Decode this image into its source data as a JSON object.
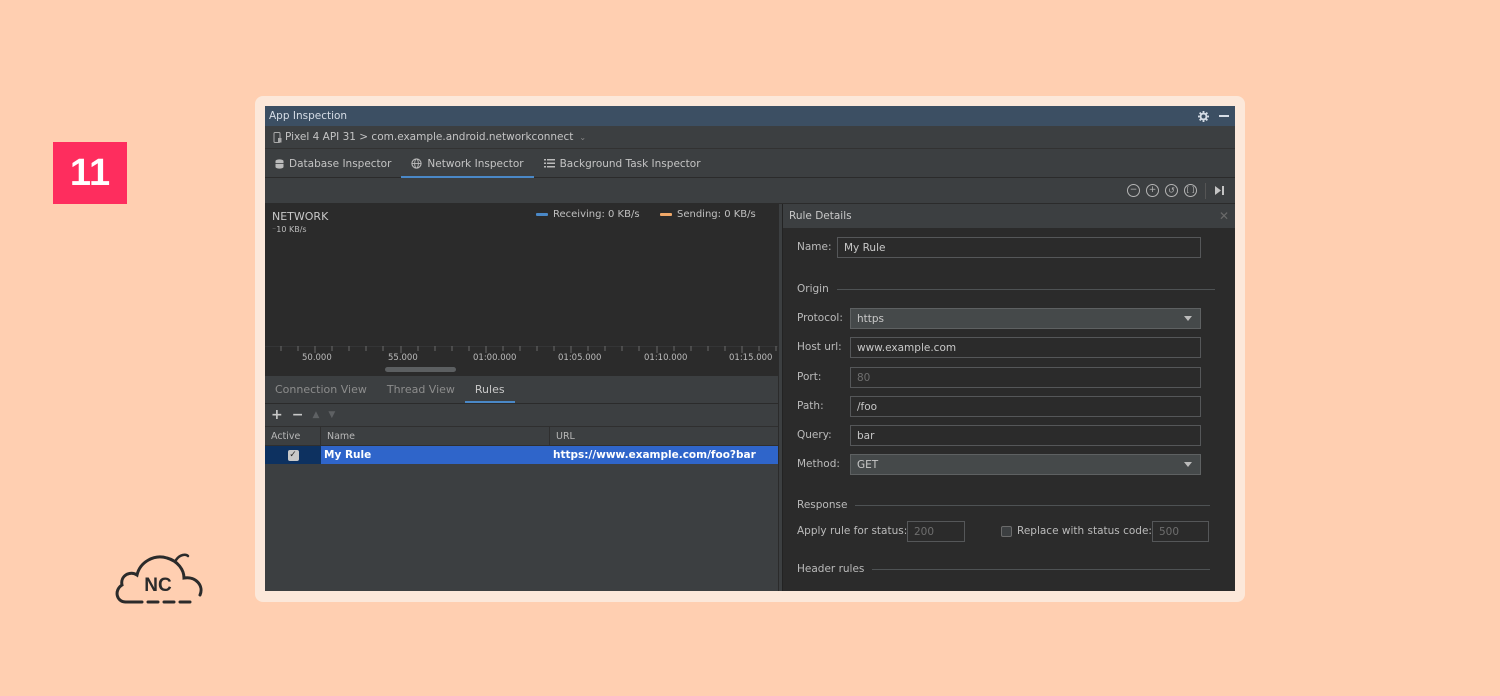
{
  "badge": {
    "number": "11",
    "color": "#fe2d5e"
  },
  "logo": {
    "text": "NC"
  },
  "window": {
    "title": "App Inspection",
    "icons": [
      "gear-icon",
      "minimize-icon"
    ]
  },
  "device": {
    "path": "Pixel 4 API 31 > com.example.android.networkconnect",
    "icon": "device-icon"
  },
  "tabs": [
    {
      "label": "Database Inspector",
      "icon": "database-icon"
    },
    {
      "label": "Network Inspector",
      "icon": "globe-icon",
      "active": true
    },
    {
      "label": "Background Task Inspector",
      "icon": "list-icon"
    }
  ],
  "toolbar": {
    "buttons": [
      "zoom-out-icon",
      "zoom-in-icon",
      "reset-zoom-icon",
      "zoom-to-selection-icon",
      "go-live-icon"
    ]
  },
  "chart": {
    "title": "NETWORK",
    "scale": "10 KB/s",
    "legend": [
      {
        "label": "Receiving: 0 KB/s",
        "color": "#4a88c7"
      },
      {
        "label": "Sending: 0 KB/s",
        "color": "#f0a868"
      }
    ],
    "ticks": [
      "50.000",
      "55.000",
      "01:00.000",
      "01:05.000",
      "01:10.000",
      "01:15.000"
    ]
  },
  "lower_tabs": [
    {
      "label": "Connection View"
    },
    {
      "label": "Thread View"
    },
    {
      "label": "Rules",
      "active": true
    }
  ],
  "rules_toolbar": {
    "add": "+",
    "remove": "−"
  },
  "rules_table": {
    "headers": {
      "active": "Active",
      "name": "Name",
      "url": "URL"
    },
    "rows": [
      {
        "active": "✓",
        "name": "My Rule",
        "url": "https://www.example.com/foo?bar"
      }
    ]
  },
  "details": {
    "title": "Rule Details",
    "close": "✕",
    "name_label": "Name:",
    "name_value": "My Rule",
    "origin_label": "Origin",
    "protocol_label": "Protocol:",
    "protocol_value": "https",
    "host_label": "Host url:",
    "host_value": "www.example.com",
    "port_label": "Port:",
    "port_placeholder": "80",
    "path_label": "Path:",
    "path_value": "/foo",
    "query_label": "Query:",
    "query_value": "bar",
    "method_label": "Method:",
    "method_value": "GET",
    "response_label": "Response",
    "apply_label": "Apply rule for status:",
    "apply_placeholder": "200",
    "replace_label": "Replace with status code:",
    "replace_placeholder": "500",
    "header_rules_label": "Header rules"
  }
}
